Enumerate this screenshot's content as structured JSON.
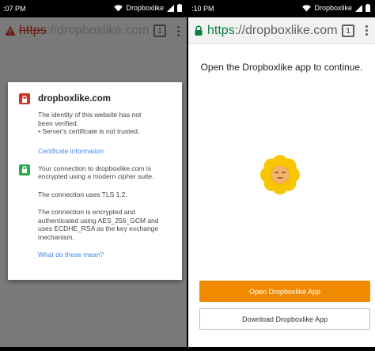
{
  "left_phone": {
    "status": {
      "time": ":07 PM",
      "carrier": "Dropboxlike"
    },
    "urlbar": {
      "scheme": "https",
      "rest": "://dropboxlike.com/sl",
      "tab_count": "1"
    },
    "dialog": {
      "site": "dropboxlike.com",
      "warning_lines": [
        "The identity of this website has not",
        "been verified.",
        "• Server's certificate is not trusted."
      ],
      "cert_link": "Certificate information",
      "secure_lines": [
        "Your connection to dropboxlike.com is",
        "encrypted using a modern cipher suite."
      ],
      "tls_line": "The connection uses TLS 1.2.",
      "cipher_lines": [
        "The connection is encrypted and",
        "authenticated using AES_256_GCM and",
        "uses ECDHE_RSA as the key exchange",
        "mechanism."
      ],
      "meaning_link": "What do these mean?"
    }
  },
  "right_phone": {
    "status": {
      "time": ":10 PM",
      "carrier": "Dropboxlike"
    },
    "urlbar": {
      "scheme": "https",
      "rest": "://dropboxlike.com/sl",
      "tab_count": "1"
    },
    "title": "Open the Dropboxlike app to continue.",
    "primary_button": "Open Dropboxlike App",
    "secondary_button": "Download Dropboxlike App"
  },
  "colors": {
    "accent_orange": "#f08a00",
    "link_blue": "#4285f4",
    "error_red": "#c53929",
    "secure_green": "#2fa84f",
    "flower_yellow": "#f7c600"
  },
  "icons": [
    "warning-icon",
    "lock-icon",
    "tabs-icon",
    "menu-icon",
    "wifi-icon",
    "signal-icon",
    "battery-icon",
    "flower-mascot-icon"
  ]
}
